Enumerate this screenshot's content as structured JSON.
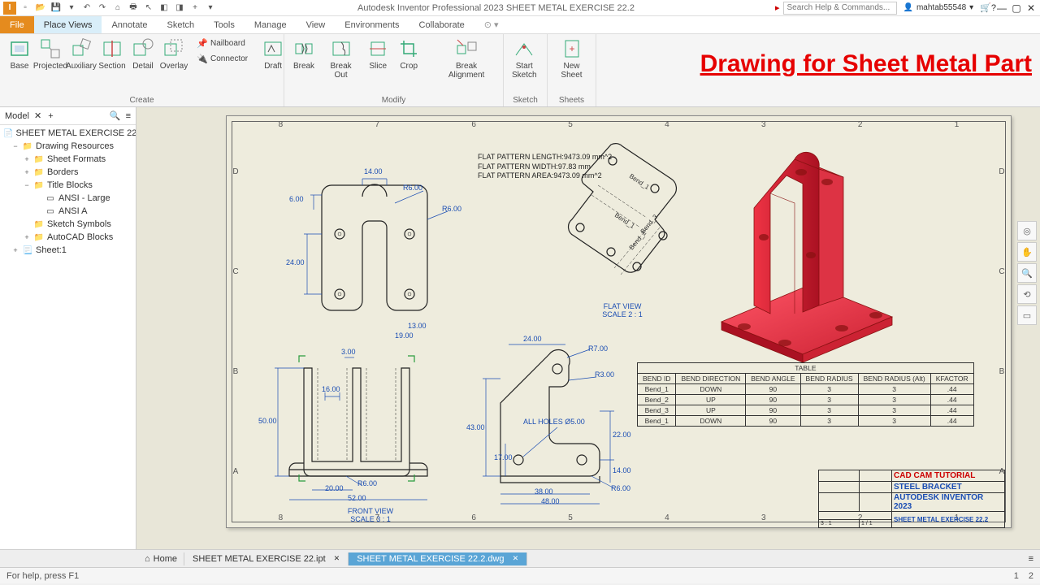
{
  "app": {
    "title": "Autodesk Inventor Professional 2023   SHEET METAL EXERCISE 22.2",
    "search_placeholder": "Search Help & Commands...",
    "user": "mahtab55548"
  },
  "tabs": {
    "file": "File",
    "items": [
      "Place Views",
      "Annotate",
      "Sketch",
      "Tools",
      "Manage",
      "View",
      "Environments",
      "Collaborate"
    ],
    "active": 0
  },
  "ribbon": {
    "create": {
      "label": "Create",
      "base": "Base",
      "projected": "Projected",
      "auxiliary": "Auxiliary",
      "section": "Section",
      "detail": "Detail",
      "overlay": "Overlay",
      "nailboard": "Nailboard",
      "connector": "Connector",
      "draft": "Draft"
    },
    "modify": {
      "label": "Modify",
      "break": "Break",
      "breakout": "Break Out",
      "slice": "Slice",
      "crop": "Crop",
      "breakalign": "Break Alignment"
    },
    "sketch": {
      "label": "Sketch",
      "start": "Start\nSketch"
    },
    "sheets": {
      "label": "Sheets",
      "new": "New Sheet"
    }
  },
  "overlay_text": "Drawing for Sheet Metal Part",
  "browser": {
    "title": "Model",
    "root": "SHEET METAL EXERCISE 22.2",
    "drawing_resources": "Drawing Resources",
    "sheet_formats": "Sheet Formats",
    "borders": "Borders",
    "title_blocks": "Title Blocks",
    "ansi_large": "ANSI - Large",
    "ansi_a": "ANSI A",
    "sketch_symbols": "Sketch Symbols",
    "autocad_blocks": "AutoCAD Blocks",
    "sheet1": "Sheet:1"
  },
  "ruler": {
    "nums": [
      "8",
      "7",
      "6",
      "5",
      "4",
      "3",
      "2",
      "1"
    ],
    "letters": [
      "D",
      "C",
      "B",
      "A"
    ]
  },
  "flat_info": {
    "l1": "FLAT PATTERN LENGTH:9473.09 mm^2",
    "l2": "FLAT PATTERN WIDTH:97.83 mm",
    "l3": "FLAT PATTERN AREA:9473.09 mm^2"
  },
  "dims": {
    "d14": "14.00",
    "r6a": "R6.00",
    "r6b": "R6.00",
    "d6": "6.00",
    "d24": "24.00",
    "d13": "13.00",
    "d19": "19.00",
    "d3": "3.00",
    "d50": "50.00",
    "d16": "16.00",
    "r6c": "R6.00",
    "d20": "20.00",
    "d52": "52.00",
    "d24b": "24.00",
    "r7": "R7.00",
    "r3": "R3.00",
    "d43": "43.00",
    "d22": "22.00",
    "d17": "17.00",
    "d14b": "14.00",
    "d38": "38.00",
    "d48": "48.00",
    "r6d": "R6.00",
    "holes": "ALL HOLES Ø5.00"
  },
  "flat_bends": {
    "b1": "Bend_1",
    "b2": "Bend_2",
    "b3": "Bend_3",
    "b1b": "Bend_1"
  },
  "view_labels": {
    "flat": "FLAT VIEW",
    "flat_scale": "SCALE 2 : 1",
    "front": "FRONT VIEW",
    "front_scale": "SCALE 3 : 1"
  },
  "bend_table": {
    "title": "TABLE",
    "headers": [
      "BEND ID",
      "BEND DIRECTION",
      "BEND ANGLE",
      "BEND RADIUS",
      "BEND RADIUS (Alt)",
      "KFACTOR"
    ],
    "rows": [
      [
        "Bend_1",
        "DOWN",
        "90",
        "3",
        "3",
        ".44"
      ],
      [
        "Bend_2",
        "UP",
        "90",
        "3",
        "3",
        ".44"
      ],
      [
        "Bend_3",
        "UP",
        "90",
        "3",
        "3",
        ".44"
      ],
      [
        "Bend_1",
        "DOWN",
        "90",
        "3",
        "3",
        ".44"
      ]
    ]
  },
  "title_block": {
    "tutorial": "CAD CAM TUTORIAL",
    "part": "STEEL BRACKET",
    "app": "AUTODESK INVENTOR 2023",
    "sheet": "SHEET METAL EXERCISE 22.2",
    "scale": "3 : 1",
    "sheetno": "1  /  1"
  },
  "doctabs": {
    "home": "Home",
    "t1": "SHEET METAL EXERCISE 22.ipt",
    "t2": "SHEET METAL EXERCISE 22.2.dwg"
  },
  "status": {
    "help": "For help, press F1",
    "n1": "1",
    "n2": "2"
  }
}
